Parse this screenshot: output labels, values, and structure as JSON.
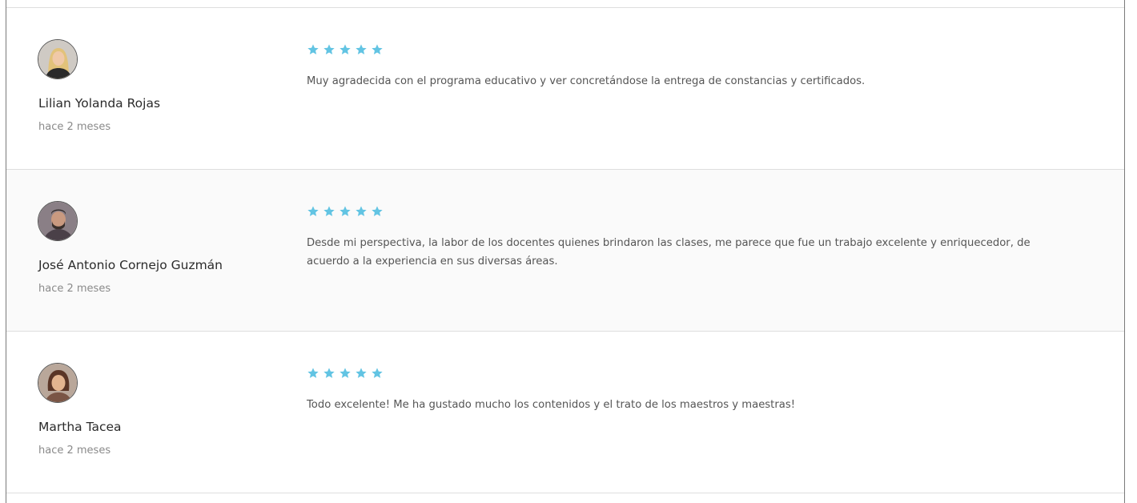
{
  "colors": {
    "star": "#62c4e3",
    "border": "#dedede",
    "alt_row_bg": "#fafafa"
  },
  "reviews": [
    {
      "author": "Lilian Yolanda Rojas",
      "time": "hace 2 meses",
      "rating": 5,
      "comment": "Muy agradecida con el programa educativo y ver concretándose la entrega de constancias y certificados."
    },
    {
      "author": "José Antonio Cornejo Guzmán",
      "time": "hace 2 meses",
      "rating": 5,
      "comment": "Desde mi perspectiva, la labor de los docentes quienes brindaron las clases, me parece que fue un trabajo excelente y enriquecedor, de acuerdo a la experiencia en sus diversas áreas."
    },
    {
      "author": "Martha Tacea",
      "time": "hace 2 meses",
      "rating": 5,
      "comment": "Todo excelente! Me ha gustado mucho los contenidos y el trato de los maestros y maestras!"
    }
  ]
}
